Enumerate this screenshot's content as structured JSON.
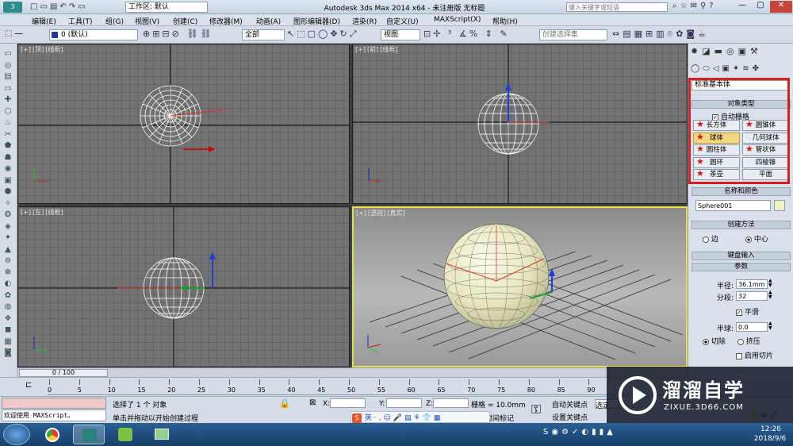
{
  "window": {
    "title": "Autodesk 3ds Max  2014 x64  - 未注册版  无标题",
    "workspace": "工作区: 默认",
    "search_placeholder": "键入关键字或短语"
  },
  "menu": [
    "编辑(E)",
    "工具(T)",
    "组(G)",
    "视图(V)",
    "创建(C)",
    "修改器(M)",
    "动画(A)",
    "图形编辑器(D)",
    "渲染(R)",
    "自定义(U)",
    "MAXScript(X)",
    "帮助(H)"
  ],
  "toolbar": {
    "layer": "0 (默认)",
    "filter": "全部",
    "refcoord": "视图",
    "selset": "创建选择集"
  },
  "viewports": {
    "top": [
      "[+]",
      "[顶]",
      "[线框]"
    ],
    "front": [
      "[+]",
      "[前]",
      "[线框]"
    ],
    "left": [
      "[+]",
      "[左]",
      "[线框]"
    ],
    "persp": [
      "[+]",
      "[透视]",
      "[真实]"
    ]
  },
  "cmd": {
    "category": "标准基本体",
    "object_type_header": "对象类型",
    "autogrid": "自动栅格",
    "objects": [
      "长方体",
      "圆锥体",
      "球体",
      "几何球体",
      "圆柱体",
      "管状体",
      "圆环",
      "四棱锥",
      "茶壶",
      "平面"
    ],
    "name_color_header": "名称和颜色",
    "object_name": "Sphere001",
    "creation_method_header": "创建方法",
    "edge": "边",
    "center": "中心",
    "keyboard_header": "键盘输入",
    "params_header": "参数",
    "radius_label": "半径:",
    "radius": "36.1mm",
    "segments_label": "分段:",
    "segments": "32",
    "smooth": "平滑",
    "hemisphere_label": "半球:",
    "hemisphere": "0.0",
    "chop": "切除",
    "squash": "挤压",
    "slice": "启用切片"
  },
  "timeline": {
    "frame": "0 / 100",
    "ticks": [
      "0",
      "5",
      "10",
      "15",
      "20",
      "25",
      "30",
      "35",
      "40",
      "45",
      "50",
      "55",
      "60",
      "65",
      "70",
      "75",
      "80",
      "85",
      "90"
    ]
  },
  "status": {
    "welcome": "欢迎使用 MAXScript。",
    "selected": "选择了 1 个 对象",
    "prompt": "单击并拖动以开始创建过程",
    "x": "X:",
    "y": "Y:",
    "z": "Z:",
    "grid": "栅格 = 10.0mm",
    "autokey": "自动关键点",
    "setkey": "设置关键点",
    "selected_mode": "选定",
    "add_time_tag": "添加时间标记",
    "ime": "英"
  },
  "watermark": {
    "name": "溜溜自学",
    "url": "ZIXUE.3D66.COM"
  },
  "clock": {
    "time": "12:26",
    "date": "2018/9/6"
  },
  "colors": {
    "selection_box": "#d61f1f",
    "active_viewport": "#e8dd46",
    "object_btn_selected": "#f3d782"
  }
}
